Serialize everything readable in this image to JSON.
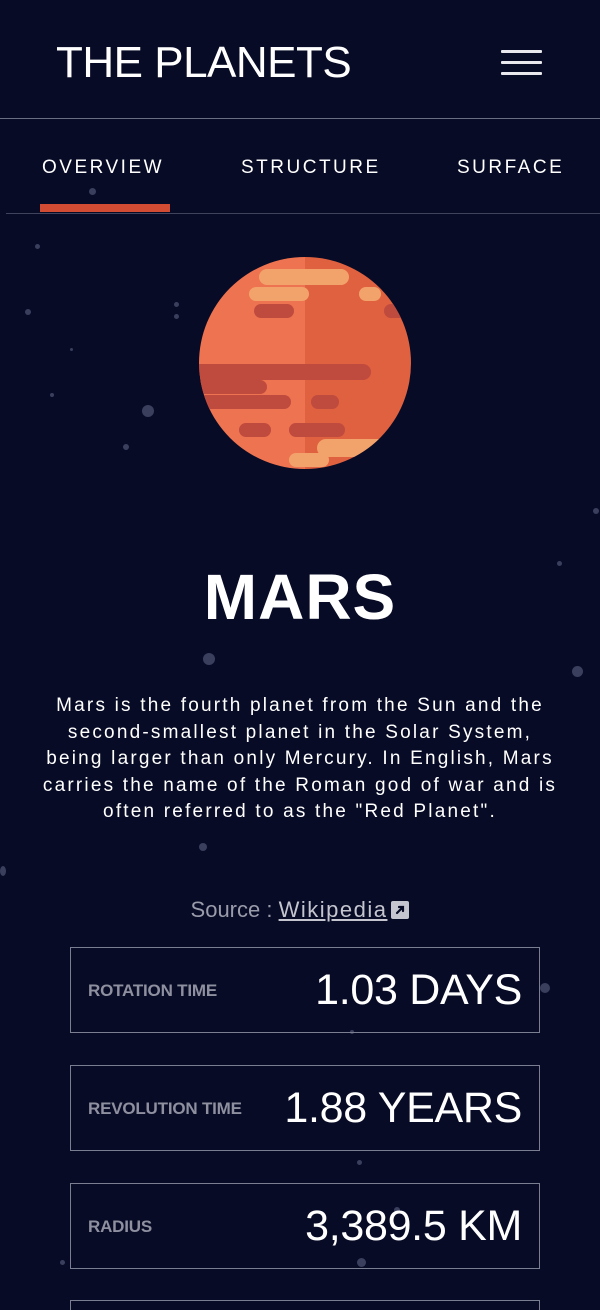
{
  "header": {
    "title": "THE PLANETS",
    "menu_icon": "hamburger-menu-icon"
  },
  "tabs": [
    {
      "label": "OVERVIEW",
      "active": true
    },
    {
      "label": "STRUCTURE",
      "active": false
    },
    {
      "label": "SURFACE",
      "active": false
    }
  ],
  "colors": {
    "background": "#070B25",
    "accent": "#D14C32",
    "planet_light": "#EE7350",
    "planet_shadow": "#E0613F",
    "planet_band": "#BF4A3E",
    "planet_highlight": "#F2A36B"
  },
  "planet": {
    "name": "MARS",
    "description": "Mars is the fourth planet from the Sun and the second-smallest planet in the Solar System, being larger than only Mercury. In English, Mars carries the name of the Roman god of war and is often referred to as the \"Red Planet\".",
    "source_prefix": "Source : ",
    "source_link": "Wikipedia",
    "source_icon": "external-link-icon"
  },
  "stats": [
    {
      "label": "ROTATION TIME",
      "value": "1.03 DAYS"
    },
    {
      "label": "REVOLUTION TIME",
      "value": "1.88 YEARS"
    },
    {
      "label": "RADIUS",
      "value": "3,389.5 KM"
    }
  ]
}
